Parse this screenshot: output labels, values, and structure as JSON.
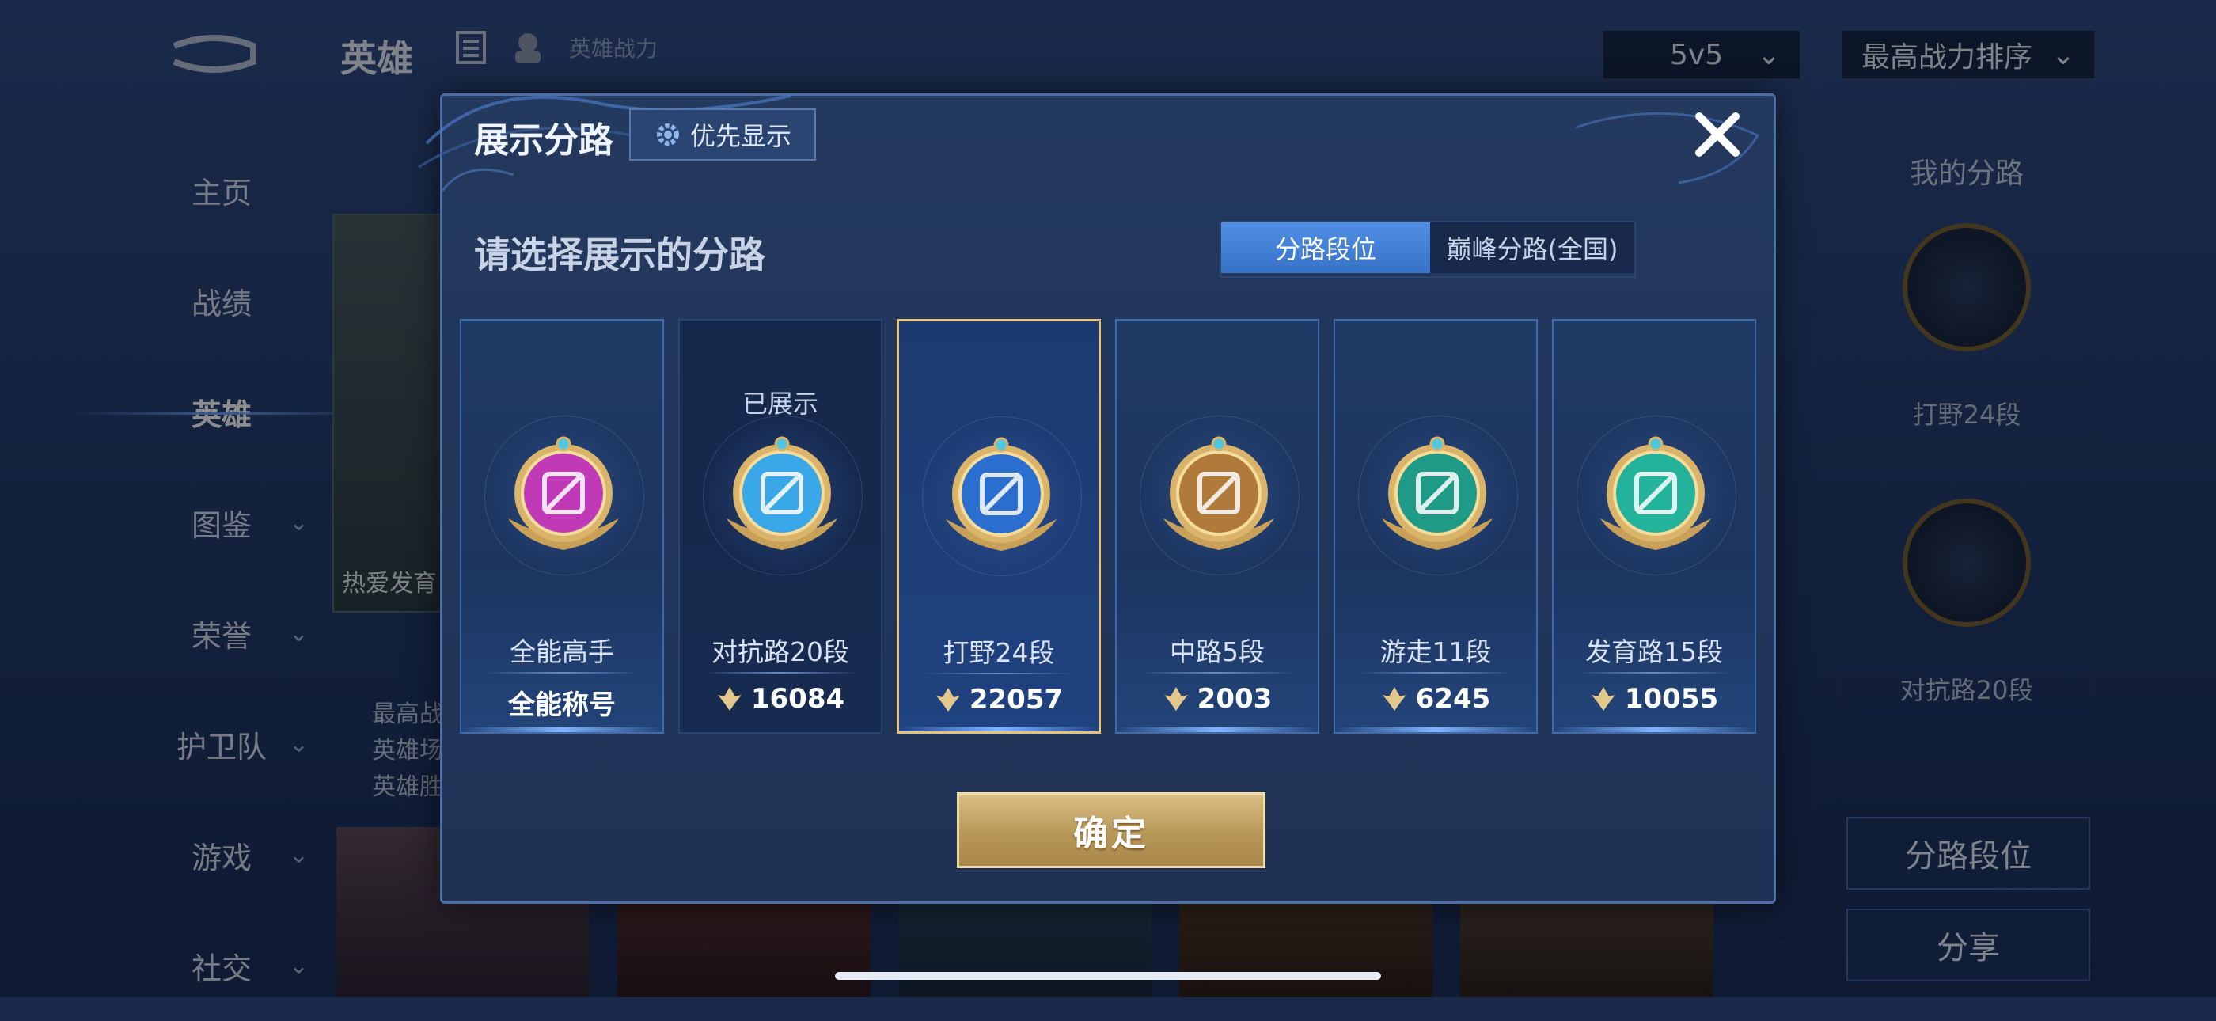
{
  "background": {
    "top_title": "英雄",
    "top_power_label": "英雄战力",
    "mode_select": "5v5",
    "sort_select": "最高战力排序",
    "nav": [
      {
        "label": "主页",
        "chevron": false
      },
      {
        "label": "战绩",
        "chevron": false
      },
      {
        "label": "英雄",
        "chevron": false,
        "active": true
      },
      {
        "label": "图鉴",
        "chevron": true
      },
      {
        "label": "荣誉",
        "chevron": true
      },
      {
        "label": "护卫队",
        "chevron": true
      },
      {
        "label": "游戏",
        "chevron": true
      },
      {
        "label": "社交",
        "chevron": true
      }
    ],
    "hero_card_text": "热爱发育",
    "hero_info": [
      "最高战",
      "英雄场",
      "英雄胜"
    ],
    "right_panel": {
      "title": "我的分路",
      "lane1": "打野24段",
      "lane2": "对抗路20段",
      "button_lane": "分路段位",
      "button_share": "分享"
    }
  },
  "dialog": {
    "title": "展示分路",
    "priority_button": "优先显示",
    "subtitle": "请选择展示的分路",
    "tabs": [
      {
        "label": "分路段位",
        "active": true
      },
      {
        "label": "巅峰分路(全国)",
        "active": false
      }
    ],
    "cards": [
      {
        "name": "全能高手",
        "score": "全能称号",
        "has_icon": false,
        "shown_label": "",
        "state": "normal",
        "badge": "allround-badge",
        "color": "#c03ab8"
      },
      {
        "name": "对抗路20段",
        "score": "16084",
        "has_icon": true,
        "shown_label": "已展示",
        "state": "shown",
        "badge": "clash-lane-badge",
        "color": "#3aa8e8"
      },
      {
        "name": "打野24段",
        "score": "22057",
        "has_icon": true,
        "shown_label": "",
        "state": "selected",
        "badge": "jungle-badge",
        "color": "#2a6fd0"
      },
      {
        "name": "中路5段",
        "score": "2003",
        "has_icon": true,
        "shown_label": "",
        "state": "normal",
        "badge": "mid-lane-badge",
        "color": "#b07a3a"
      },
      {
        "name": "游走11段",
        "score": "6245",
        "has_icon": true,
        "shown_label": "",
        "state": "normal",
        "badge": "roam-badge",
        "color": "#1f9a86"
      },
      {
        "name": "发育路15段",
        "score": "10055",
        "has_icon": true,
        "shown_label": "",
        "state": "normal",
        "badge": "farm-lane-badge",
        "color": "#22b39a"
      }
    ],
    "confirm": "确定"
  },
  "colors": {
    "accent_gold": "#e6c27a",
    "tab_active": "#3f80d8",
    "dialog_bg": "#22375c"
  }
}
